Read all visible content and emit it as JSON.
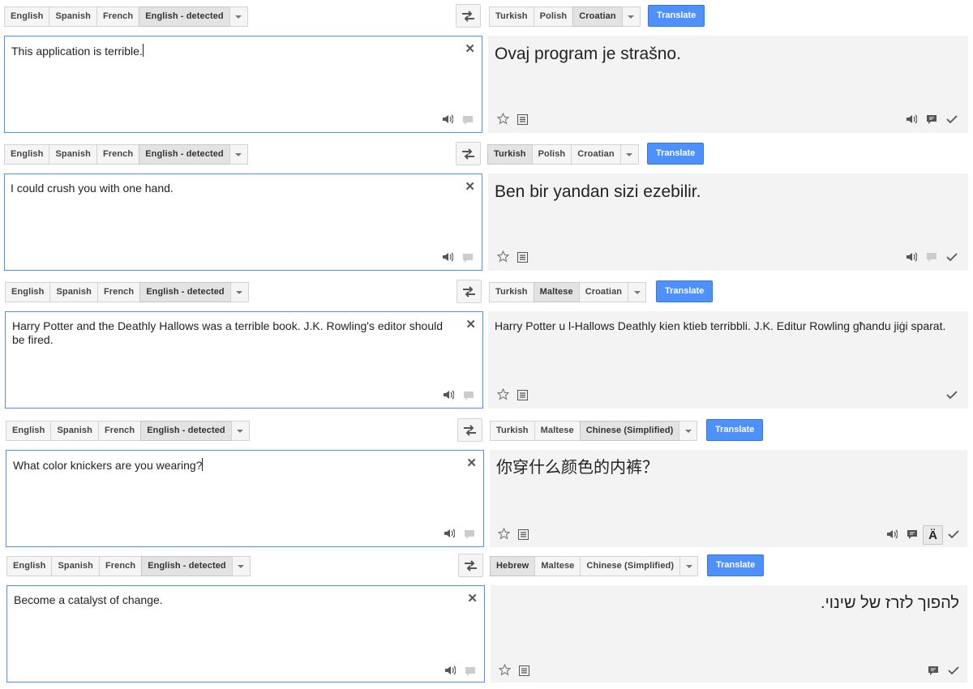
{
  "panels": [
    {
      "src_langs": [
        "English",
        "Spanish",
        "French",
        "English - detected"
      ],
      "tgt_langs": [
        "Turkish",
        "Polish",
        "Croatian"
      ],
      "translate_label": "Translate",
      "source_text": "This application is terrible.",
      "target_text": "Ovaj program je strašno."
    },
    {
      "src_langs": [
        "English",
        "Spanish",
        "French",
        "English - detected"
      ],
      "tgt_langs": [
        "Turkish",
        "Polish",
        "Croatian"
      ],
      "translate_label": "Translate",
      "source_text": "I could crush you with one hand.",
      "target_text": "Ben bir yandan sizi ezebilir."
    },
    {
      "src_langs": [
        "English",
        "Spanish",
        "French",
        "English - detected"
      ],
      "tgt_langs": [
        "Turkish",
        "Maltese",
        "Croatian"
      ],
      "translate_label": "Translate",
      "source_text": "Harry Potter and the Deathly Hallows was a terrible book. J.K. Rowling's editor should be fired.",
      "target_text": "Harry Potter u l-Hallows Deathly kien ktieb terribbli. J.K. Editur Rowling għandu jiġi sparat."
    },
    {
      "src_langs": [
        "English",
        "Spanish",
        "French",
        "English - detected"
      ],
      "tgt_langs": [
        "Turkish",
        "Maltese",
        "Chinese (Simplified)"
      ],
      "translate_label": "Translate",
      "source_text": "What color knickers are you wearing?",
      "target_text": "你穿什么颜色的内裤？",
      "font_button_label": "Ä"
    },
    {
      "src_langs": [
        "English",
        "Spanish",
        "French",
        "English - detected"
      ],
      "tgt_langs": [
        "Hebrew",
        "Maltese",
        "Chinese (Simplified)"
      ],
      "translate_label": "Translate",
      "source_text": "Become a catalyst of change.",
      "target_text": "להפוך לזרז של שינוי."
    }
  ]
}
